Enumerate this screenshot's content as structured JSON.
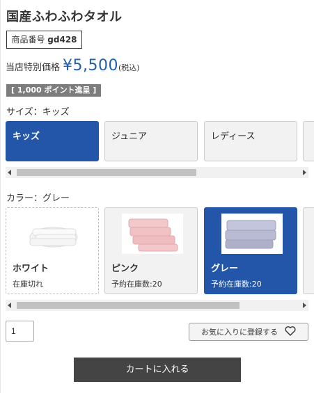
{
  "product": {
    "title": "国産ふわふわタオル",
    "sku_label": "商品番号",
    "sku_code": "gd428"
  },
  "price": {
    "label": "当店特別価格",
    "value": "¥5,500",
    "tax_note": "(税込)"
  },
  "points_badge": "[ 1,000 ポイント進呈 ]",
  "size": {
    "label": "サイズ：キッズ",
    "options": [
      "キッズ",
      "ジュニア",
      "レディース"
    ],
    "selected_index": 0
  },
  "color": {
    "label": "カラー：グレー",
    "options": [
      {
        "name": "ホワイト",
        "stock": "在庫切れ",
        "swatch": "#f2f2f2"
      },
      {
        "name": "ピンク",
        "stock": "予約在庫数:20",
        "swatch": "#f1c6c8"
      },
      {
        "name": "グレー",
        "stock": "予約在庫数:20",
        "swatch": "#b8bbd2"
      }
    ],
    "selected_index": 2
  },
  "quantity": "1",
  "favorite_label": "お気に入りに登録する",
  "cart_label": "カートに入れる",
  "colors": {
    "accent": "#2356a8",
    "price": "#1d5fb5",
    "cart": "#444444"
  }
}
